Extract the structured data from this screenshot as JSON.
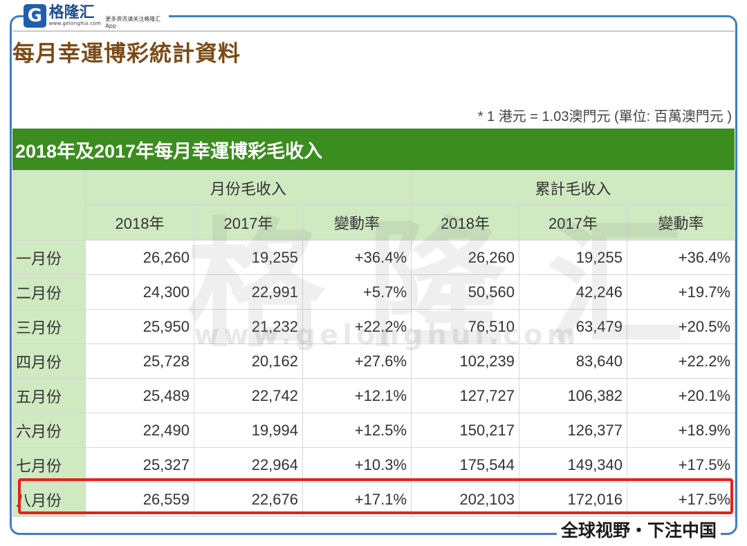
{
  "brand": {
    "logo_letter": "G",
    "name": "格隆汇",
    "url": "www.gelonghui.com",
    "tagline": "更多资讯请关注格隆汇App",
    "frame_color": "#3d7fc4"
  },
  "page_title": "每月幸運博彩統計資料",
  "note": "* 1 港元 = 1.03澳門元 (單位: 百萬澳門元 )",
  "table": {
    "title": "2018年及2017年每月幸運博彩毛收入",
    "group_headers": [
      "月份毛收入",
      "累計毛收入"
    ],
    "sub_headers": [
      "2018年",
      "2017年",
      "變動率",
      "2018年",
      "2017年",
      "變動率"
    ],
    "rows": [
      {
        "month": "一月份",
        "cells": [
          "26,260",
          "19,255",
          "+36.4%",
          "26,260",
          "19,255",
          "+36.4%"
        ]
      },
      {
        "month": "二月份",
        "cells": [
          "24,300",
          "22,991",
          "+5.7%",
          "50,560",
          "42,246",
          "+19.7%"
        ]
      },
      {
        "month": "三月份",
        "cells": [
          "25,950",
          "21,232",
          "+22.2%",
          "76,510",
          "63,479",
          "+20.5%"
        ]
      },
      {
        "month": "四月份",
        "cells": [
          "25,728",
          "20,162",
          "+27.6%",
          "102,239",
          "83,640",
          "+22.2%"
        ]
      },
      {
        "month": "五月份",
        "cells": [
          "25,489",
          "22,742",
          "+12.1%",
          "127,727",
          "106,382",
          "+20.1%"
        ]
      },
      {
        "month": "六月份",
        "cells": [
          "22,490",
          "19,994",
          "+12.5%",
          "150,217",
          "126,377",
          "+18.9%"
        ]
      },
      {
        "month": "七月份",
        "cells": [
          "25,327",
          "22,964",
          "+10.3%",
          "175,544",
          "149,340",
          "+17.5%"
        ]
      },
      {
        "month": "八月份",
        "cells": [
          "26,559",
          "22,676",
          "+17.1%",
          "202,103",
          "172,016",
          "+17.5%"
        ]
      }
    ],
    "highlighted_row": "八月份",
    "header_color": "#3a8d1e",
    "subheader_color": "#cfe9c1",
    "highlight_color": "#e2231a"
  },
  "watermark": {
    "text": "格隆汇",
    "url": "www.gelonghui.com"
  },
  "slogan": "全球视野・下注中国"
}
